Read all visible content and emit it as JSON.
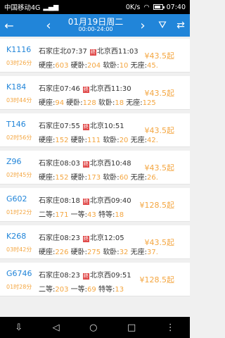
{
  "status": {
    "carrier": "中国移动4G",
    "speed": "0K/s",
    "time": "07:40",
    "battery_level": 0.8
  },
  "header": {
    "date": "01月19日周二",
    "time_range": "00:00-24:00"
  },
  "icons": {
    "back": "←",
    "prev": "‹",
    "next": "›",
    "filter": "⛛",
    "swap": "⇄",
    "arrive_badge": "终",
    "nav_back": "◁",
    "nav_home": "○",
    "nav_recent": "□",
    "nav_hide": "⇩",
    "nav_menu": "⋮"
  },
  "colors": {
    "accent": "#2185d9",
    "price": "#f4a640",
    "arrive_badge": "#e04b4b"
  },
  "trains": [
    {
      "code": "K1116",
      "duration": "03时26分",
      "from": "石家庄北",
      "dep": "07:37",
      "to": "北京西",
      "arr": "11:03",
      "price": "¥43.5起",
      "seats": [
        {
          "label": "硬座:",
          "count": "603"
        },
        {
          "label": "硬卧:",
          "count": "204"
        },
        {
          "label": "软卧:",
          "count": "10"
        },
        {
          "label": "无座:",
          "count": "45..."
        }
      ]
    },
    {
      "code": "K184",
      "duration": "03时44分",
      "from": "石家庄",
      "dep": "07:46",
      "to": "北京西",
      "arr": "11:30",
      "price": "¥43.5起",
      "seats": [
        {
          "label": "硬座:",
          "count": "94"
        },
        {
          "label": "硬卧:",
          "count": "128"
        },
        {
          "label": "软卧:",
          "count": "18"
        },
        {
          "label": "无座:",
          "count": "125"
        }
      ]
    },
    {
      "code": "T146",
      "duration": "02时56分",
      "from": "石家庄",
      "dep": "07:55",
      "to": "北京",
      "arr": "10:51",
      "price": "¥43.5起",
      "seats": [
        {
          "label": "硬座:",
          "count": "152"
        },
        {
          "label": "硬卧:",
          "count": "111"
        },
        {
          "label": "软卧:",
          "count": "20"
        },
        {
          "label": "无座:",
          "count": "42..."
        }
      ]
    },
    {
      "code": "Z96",
      "duration": "02时45分",
      "from": "石家庄",
      "dep": "08:03",
      "to": "北京西",
      "arr": "10:48",
      "price": "¥43.5起",
      "seats": [
        {
          "label": "硬座:",
          "count": "152"
        },
        {
          "label": "硬卧:",
          "count": "173"
        },
        {
          "label": "软卧:",
          "count": "60"
        },
        {
          "label": "无座:",
          "count": "26..."
        }
      ]
    },
    {
      "code": "G602",
      "duration": "01时22分",
      "from": "石家庄",
      "dep": "08:18",
      "to": "北京西",
      "arr": "09:40",
      "price": "¥128.5起",
      "seats": [
        {
          "label": "二等:",
          "count": "171"
        },
        {
          "label": "一等:",
          "count": "43"
        },
        {
          "label": "特等:",
          "count": "18"
        }
      ]
    },
    {
      "code": "K268",
      "duration": "03时42分",
      "from": "石家庄",
      "dep": "08:23",
      "to": "北京",
      "arr": "12:05",
      "price": "¥43.5起",
      "seats": [
        {
          "label": "硬座:",
          "count": "226"
        },
        {
          "label": "硬卧:",
          "count": "275"
        },
        {
          "label": "软卧:",
          "count": "32"
        },
        {
          "label": "无座:",
          "count": "37..."
        }
      ]
    },
    {
      "code": "G6746",
      "duration": "01时28分",
      "from": "石家庄",
      "dep": "08:23",
      "to": "北京西",
      "arr": "09:51",
      "price": "¥128.5起",
      "seats": [
        {
          "label": "二等:",
          "count": "203"
        },
        {
          "label": "一等:",
          "count": "69"
        },
        {
          "label": "特等:",
          "count": "13"
        }
      ]
    }
  ]
}
